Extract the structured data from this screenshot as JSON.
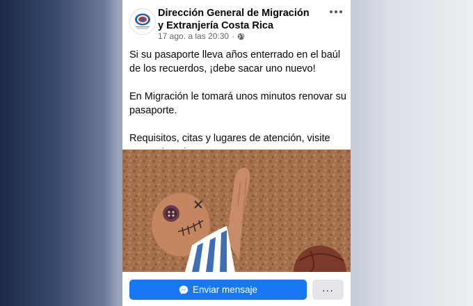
{
  "post": {
    "page_name": "Dirección General de Migración y Extranjería Costa Rica",
    "timestamp": "17 ago. a las 20:30",
    "separator": "·",
    "privacy_icon": "globe-icon",
    "options_icon": "more-dots-icon",
    "paragraphs": [
      "Si su pasaporte lleva años enterrado en el baúl de los recuerdos, ¡debe sacar uno nuevo!",
      "En Migración le tomará unos minutos renovar su pasaporte."
    ],
    "last_paragraph": "Requisitos, citas y lugares de atención, visite",
    "link": "www.migracion.go.cr"
  },
  "footer": {
    "message_button": "Enviar mensaje",
    "messenger_icon": "messenger-icon",
    "more_button": "···"
  },
  "colors": {
    "accent": "#1877f2",
    "secondary_text": "#65676b",
    "secondary_button": "#e4e6eb"
  }
}
